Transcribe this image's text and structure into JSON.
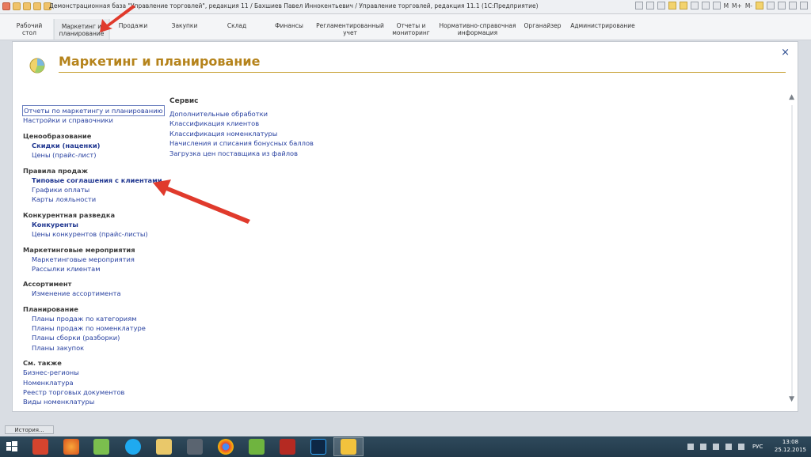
{
  "window": {
    "title": "Демонстрационная база \"Управление торговлей\", редакция 11 / Бахшиев Павел Иннокентьевич / Управление торговлей, редакция 11.1 (1С:Предприятие)",
    "controls": [
      "M",
      "M+",
      "M-"
    ]
  },
  "sections": [
    {
      "label": "Рабочий\nстол",
      "active": false
    },
    {
      "label": "Маркетинг и\nпланирование",
      "active": true
    },
    {
      "label": "Продажи",
      "active": false
    },
    {
      "label": "Закупки",
      "active": false
    },
    {
      "label": "Склад",
      "active": false
    },
    {
      "label": "Финансы",
      "active": false
    },
    {
      "label": "Регламентированный\nучет",
      "active": false
    },
    {
      "label": "Отчеты и\nмониторинг",
      "active": false
    },
    {
      "label": "Нормативно-справочная\nинформация",
      "active": false
    },
    {
      "label": "Органайзер",
      "active": false
    },
    {
      "label": "Администрирование",
      "active": false
    }
  ],
  "panel": {
    "title": "Маркетинг и планирование",
    "close_glyph": "×",
    "top_links": [
      "Отчеты по маркетингу и планированию",
      "Настройки и справочники"
    ],
    "groups": [
      {
        "title": "Ценообразование",
        "items": [
          {
            "label": "Скидки (наценки)",
            "bold": true
          },
          {
            "label": "Цены (прайс-лист)",
            "bold": false
          }
        ]
      },
      {
        "title": "Правила продаж",
        "items": [
          {
            "label": "Типовые соглашения с клиентами",
            "bold": true
          },
          {
            "label": "Графики оплаты",
            "bold": false
          },
          {
            "label": "Карты лояльности",
            "bold": false
          }
        ]
      },
      {
        "title": "Конкурентная разведка",
        "items": [
          {
            "label": "Конкуренты",
            "bold": true
          },
          {
            "label": "Цены конкурентов (прайс-листы)",
            "bold": false
          }
        ]
      },
      {
        "title": "Маркетинговые мероприятия",
        "items": [
          {
            "label": "Маркетинговые мероприятия",
            "bold": false
          },
          {
            "label": "Рассылки клиентам",
            "bold": false
          }
        ]
      },
      {
        "title": "Ассортимент",
        "items": [
          {
            "label": "Изменение ассортимента",
            "bold": false
          }
        ]
      },
      {
        "title": "Планирование",
        "items": [
          {
            "label": "Планы продаж по категориям",
            "bold": false
          },
          {
            "label": "Планы продаж по номенклатуре",
            "bold": false
          },
          {
            "label": "Планы сборки (разборки)",
            "bold": false
          },
          {
            "label": "Планы закупок",
            "bold": false
          }
        ]
      }
    ],
    "see_also": {
      "title": "См. также",
      "items": [
        "Бизнес-регионы",
        "Номенклатура",
        "Реестр торговых документов",
        "Виды номенклатуры"
      ]
    },
    "service": {
      "title": "Сервис",
      "items": [
        "Дополнительные обработки",
        "Классификация клиентов",
        "Классификация номенклатуры",
        "Начисления и списания бонусных баллов",
        "Загрузка цен поставщика из файлов"
      ]
    }
  },
  "history_button": "История...",
  "taskbar": {
    "lang": "РУС",
    "time": "13:08",
    "date": "25.12.2015",
    "apps": [
      "start-icon",
      "antivirus-icon",
      "firefox-icon",
      "archive-icon",
      "skype-icon",
      "explorer-icon",
      "phone-icon",
      "chrome-icon",
      "utorrent-icon",
      "filezilla-icon",
      "photoshop-icon",
      "1c-icon"
    ]
  },
  "colors": {
    "accent_title": "#b5831b",
    "link": "#2740a0",
    "arrow": "#e03a2c"
  }
}
